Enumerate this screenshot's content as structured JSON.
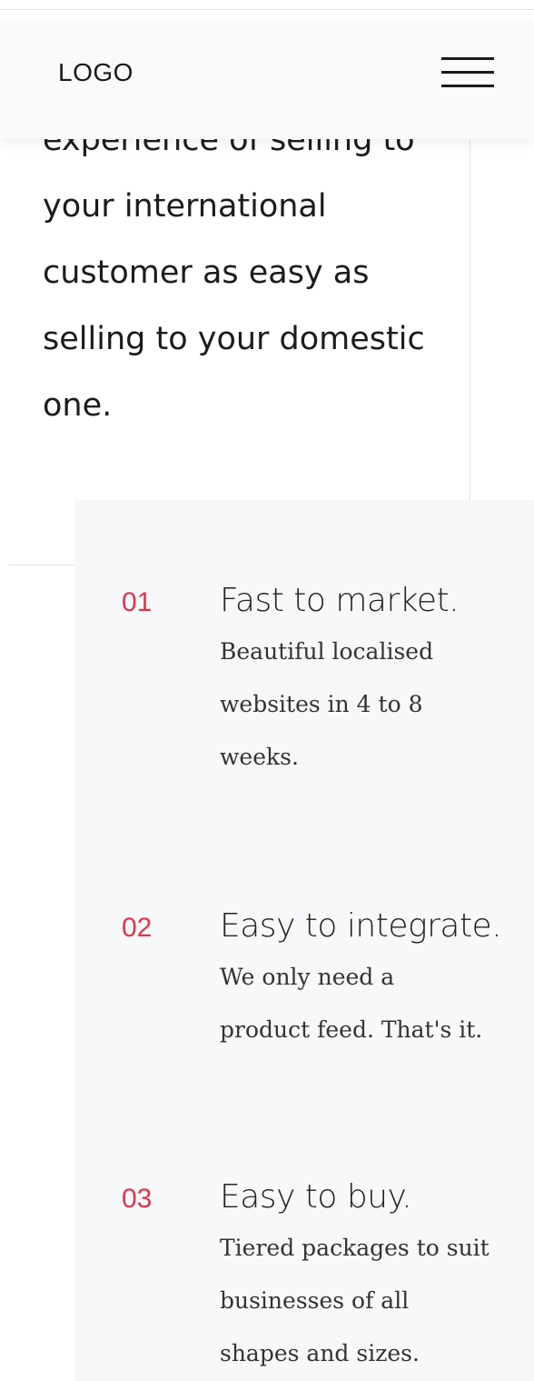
{
  "header": {
    "logo": "LOGO",
    "menu_icon": "hamburger-menu-icon"
  },
  "hero": {
    "lines": [
      "experience of selling to",
      "your international",
      "customer as easy as",
      "selling to your domestic",
      "one."
    ]
  },
  "features": [
    {
      "number": "01",
      "title": "Fast to market.",
      "desc_lines": [
        "Beautiful localised",
        "websites in 4 to 8",
        "weeks."
      ]
    },
    {
      "number": "02",
      "title": "Easy to integrate.",
      "desc_lines": [
        "We only need a",
        "product feed. That's it."
      ]
    },
    {
      "number": "03",
      "title": "Easy to buy.",
      "desc_lines": [
        "Tiered packages to suit",
        "businesses of all",
        "shapes and sizes."
      ]
    }
  ],
  "colors": {
    "accent": "#e0344b",
    "features_background": "#f7f8fa",
    "header_background": "#fafafa"
  }
}
